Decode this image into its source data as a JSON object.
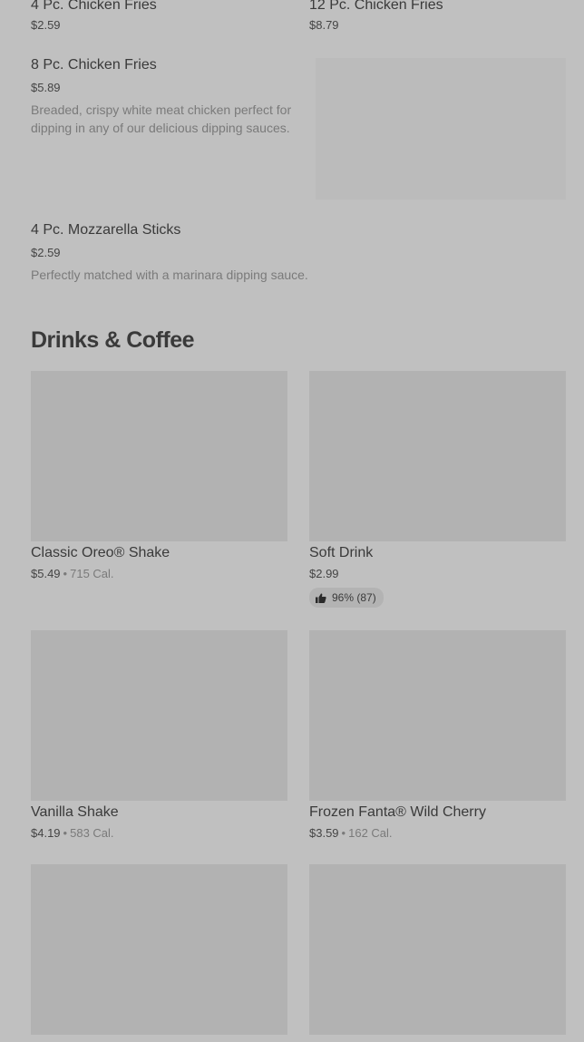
{
  "sides": {
    "items": [
      {
        "name": "4 Pc. Chicken Fries",
        "price": "$2.59"
      },
      {
        "name": "12 Pc. Chicken Fries",
        "price": "$8.79"
      },
      {
        "name": "8 Pc. Chicken Fries",
        "price": "$5.89",
        "description": "Breaded, crispy white meat chicken perfect for dipping in any of our delicious dipping sauces."
      },
      {
        "name": "4 Pc. Mozzarella Sticks",
        "price": "$2.59",
        "description": "Perfectly matched with a marinara dipping sauce."
      }
    ]
  },
  "drinks": {
    "title": "Drinks & Coffee",
    "items": [
      {
        "name": "Classic Oreo® Shake",
        "price": "$5.49",
        "separator": "•",
        "calories": "715 Cal."
      },
      {
        "name": "Soft Drink",
        "price": "$2.99",
        "rating": "96% (87)",
        "rating_icon": "thumbs-up-icon"
      },
      {
        "name": "Vanilla Shake",
        "price": "$4.19",
        "separator": "•",
        "calories": "583 Cal."
      },
      {
        "name": "Frozen Fanta® Wild Cherry",
        "price": "$3.59",
        "separator": "•",
        "calories": "162 Cal."
      }
    ]
  },
  "colors": {
    "background": "#c0c0c0",
    "image_placeholder": "#b2b2b2",
    "text_primary": "#3a3a3a",
    "text_secondary": "#7a7a7a"
  }
}
